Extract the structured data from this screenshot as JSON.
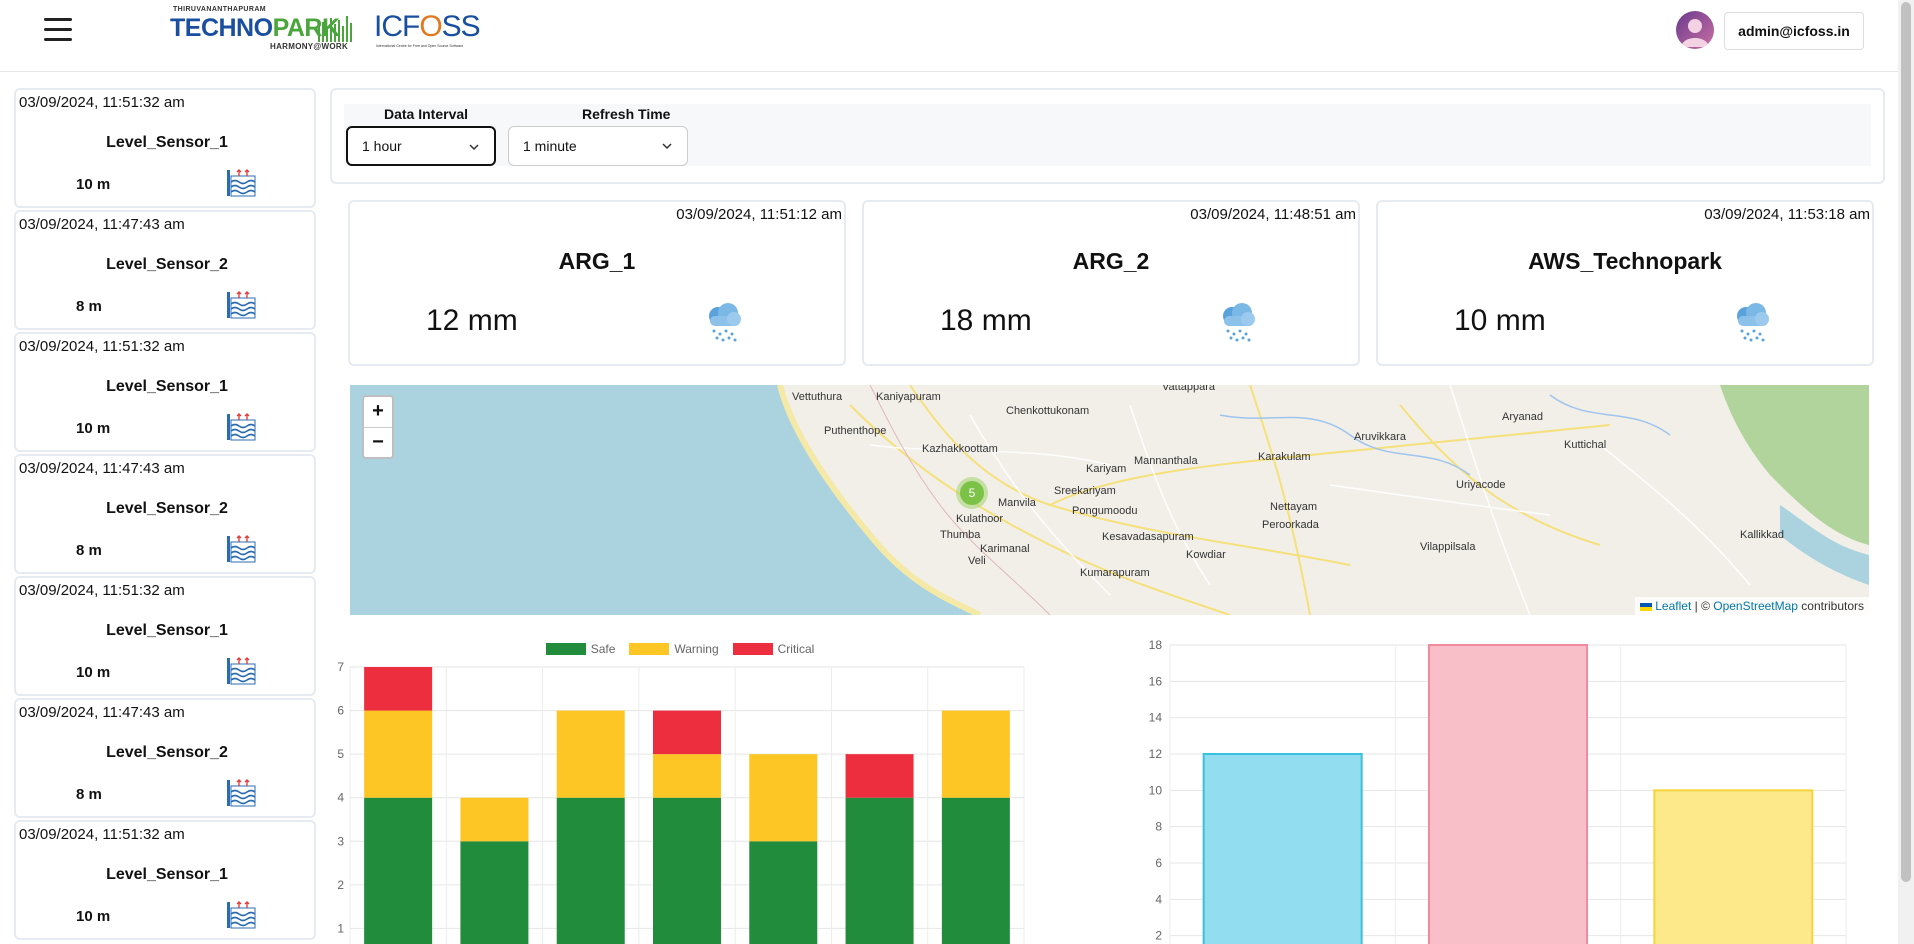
{
  "header": {
    "logo_technopark": {
      "top_text": "THIRUVANANTHAPURAM",
      "main_text_a": "TECHNO",
      "main_text_b": "PARK",
      "tagline": "HARMONY@WORK"
    },
    "logo_icfoss": {
      "main_text_a": "ICF",
      "main_text_b": "O",
      "main_text_c": "SS",
      "subtitle": "International Centre for Free and Open Source Software"
    },
    "user_label": "admin@icfoss.in"
  },
  "sidebar": {
    "cards": [
      {
        "timestamp": "03/09/2024, 11:51:32 am",
        "name": "Level_Sensor_1",
        "value": "10 m"
      },
      {
        "timestamp": "03/09/2024, 11:47:43 am",
        "name": "Level_Sensor_2",
        "value": "8 m"
      },
      {
        "timestamp": "03/09/2024, 11:51:32 am",
        "name": "Level_Sensor_1",
        "value": "10 m"
      },
      {
        "timestamp": "03/09/2024, 11:47:43 am",
        "name": "Level_Sensor_2",
        "value": "8 m"
      },
      {
        "timestamp": "03/09/2024, 11:51:32 am",
        "name": "Level_Sensor_1",
        "value": "10 m"
      },
      {
        "timestamp": "03/09/2024, 11:47:43 am",
        "name": "Level_Sensor_2",
        "value": "8 m"
      },
      {
        "timestamp": "03/09/2024, 11:51:32 am",
        "name": "Level_Sensor_1",
        "value": "10 m"
      }
    ]
  },
  "controls": {
    "data_interval_label": "Data Interval",
    "data_interval_value": "1 hour",
    "refresh_time_label": "Refresh Time",
    "refresh_time_value": "1 minute"
  },
  "rain_cards": [
    {
      "timestamp": "03/09/2024, 11:51:12 am",
      "name": "ARG_1",
      "value": "12 mm"
    },
    {
      "timestamp": "03/09/2024, 11:48:51 am",
      "name": "ARG_2",
      "value": "18 mm"
    },
    {
      "timestamp": "03/09/2024, 11:53:18 am",
      "name": "AWS_Technopark",
      "value": "10 mm"
    }
  ],
  "map": {
    "zoom_in": "+",
    "zoom_out": "−",
    "cluster_count": "5",
    "labels": [
      {
        "text": "Vettuthura"
      },
      {
        "text": "Kaniyapuram"
      },
      {
        "text": "Vattappara"
      },
      {
        "text": "Chenkottukonam"
      },
      {
        "text": "Puthenthope"
      },
      {
        "text": "Kazhakkoottam"
      },
      {
        "text": "Kariyam"
      },
      {
        "text": "Mannanthala"
      },
      {
        "text": "Karakulam"
      },
      {
        "text": "Aruvikkara"
      },
      {
        "text": "Aryanad"
      },
      {
        "text": "Kuttichal"
      },
      {
        "text": "Sreekariyam"
      },
      {
        "text": "Manvila"
      },
      {
        "text": "Pongumoodu"
      },
      {
        "text": "Nettayam"
      },
      {
        "text": "Uriyacode"
      },
      {
        "text": "Kulathoor"
      },
      {
        "text": "Thumba"
      },
      {
        "text": "Kesavadasapuram"
      },
      {
        "text": "Peroorkada"
      },
      {
        "text": "Vilappilsala"
      },
      {
        "text": "Kallikkad"
      },
      {
        "text": "Karimanal"
      },
      {
        "text": "Veli"
      },
      {
        "text": "Kowdiar"
      },
      {
        "text": "Kumarapuram"
      }
    ],
    "attribution_leaflet": "Leaflet",
    "attribution_sep": " | © ",
    "attribution_osm": "OpenStreetMap",
    "attribution_tail": " contributors"
  },
  "colors": {
    "safe": "#218c3c",
    "warning": "#fdc624",
    "critical": "#ec2e3f",
    "bar_blue_fill": "#92def0",
    "bar_blue_stroke": "#37c1dc",
    "bar_pink_fill": "#f8bfc9",
    "bar_pink_stroke": "#f08a9c",
    "bar_yellow_fill": "#fde98a",
    "bar_yellow_stroke": "#f5d33c"
  },
  "chart_data": [
    {
      "type": "bar",
      "stacked": true,
      "categories": [
        "",
        "",
        "",
        "",
        "",
        "",
        ""
      ],
      "series": [
        {
          "name": "Safe",
          "values": [
            4,
            3,
            4,
            4,
            3,
            4,
            4
          ]
        },
        {
          "name": "Warning",
          "values": [
            2,
            1,
            2,
            1,
            2,
            0,
            2
          ]
        },
        {
          "name": "Critical",
          "values": [
            1,
            0,
            0,
            1,
            0,
            1,
            0
          ]
        }
      ],
      "ylim": [
        0,
        7
      ],
      "yticks": [
        1,
        2,
        3,
        4,
        5,
        6,
        7
      ],
      "legend": "top-center",
      "grid": true
    },
    {
      "type": "bar",
      "categories": [
        "",
        "",
        ""
      ],
      "values": [
        12,
        18,
        10
      ],
      "ylim": [
        0,
        18
      ],
      "yticks": [
        2,
        4,
        6,
        8,
        10,
        12,
        14,
        16,
        18
      ],
      "grid": true
    }
  ]
}
